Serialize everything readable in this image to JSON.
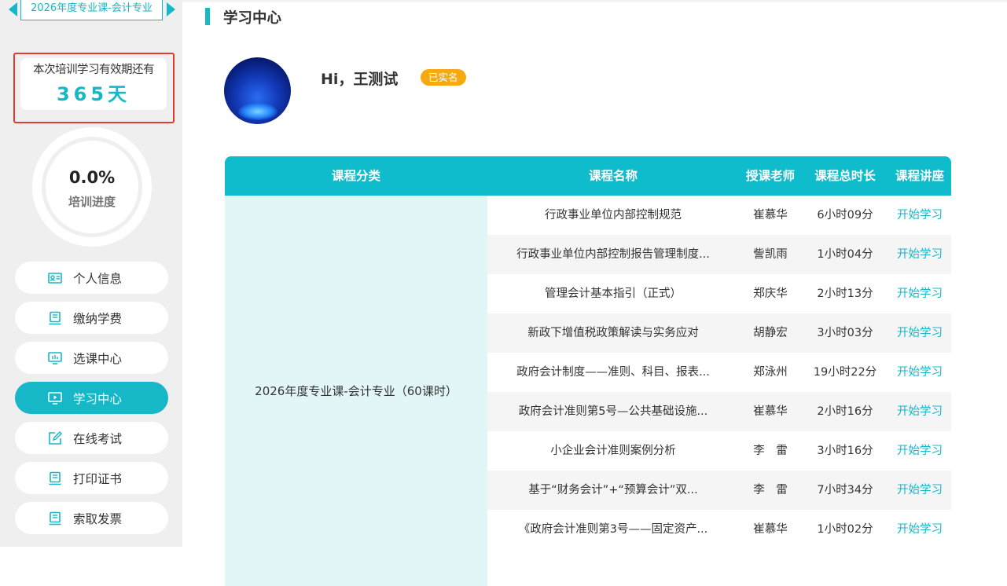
{
  "sidebar": {
    "course_name": "2026年度专业课-会计专业",
    "validity_label": "本次培训学习有效期还有",
    "validity_days": "365天",
    "progress_value": "0.0%",
    "progress_fraction": 0.0,
    "progress_label": "培训进度",
    "nav": [
      {
        "label": "个人信息",
        "icon": "id-card-icon"
      },
      {
        "label": "缴纳学费",
        "icon": "payment-icon"
      },
      {
        "label": "选课中心",
        "icon": "monitor-icon"
      },
      {
        "label": "学习中心",
        "icon": "video-icon",
        "active": true
      },
      {
        "label": "在线考试",
        "icon": "edit-icon"
      },
      {
        "label": "打印证书",
        "icon": "printer-icon"
      },
      {
        "label": "索取发票",
        "icon": "invoice-icon"
      }
    ]
  },
  "main": {
    "title": "学习中心",
    "greeting": "Hi，王测试",
    "verified_badge": "已实名"
  },
  "table": {
    "headers": {
      "category": "课程分类",
      "name": "课程名称",
      "teacher": "授课老师",
      "duration": "课程总时长",
      "action": "课程讲座"
    },
    "category": "2026年度专业课-会计专业（60课时）",
    "rows": [
      {
        "name": "行政事业单位内部控制规范",
        "teacher": "崔慕华",
        "duration": "6小时09分",
        "action": "开始学习"
      },
      {
        "name": "行政事业单位内部控制报告管理制度...",
        "teacher": "訾凯雨",
        "duration": "1小时04分",
        "action": "开始学习"
      },
      {
        "name": "管理会计基本指引（正式）",
        "teacher": "郑庆华",
        "duration": "2小时13分",
        "action": "开始学习"
      },
      {
        "name": "新政下增值税政策解读与实务应对",
        "teacher": "胡静宏",
        "duration": "3小时03分",
        "action": "开始学习"
      },
      {
        "name": "政府会计制度——准则、科目、报表...",
        "teacher": "郑泳州",
        "duration": "19小时22分",
        "action": "开始学习"
      },
      {
        "name": "政府会计准则第5号—公共基础设施...",
        "teacher": "崔慕华",
        "duration": "2小时16分",
        "action": "开始学习"
      },
      {
        "name": "小企业会计准则案例分析",
        "teacher": "李　雷",
        "duration": "3小时16分",
        "action": "开始学习"
      },
      {
        "name": "基于“财务会计”+“预算会计”双...",
        "teacher": "李　雷",
        "duration": "7小时34分",
        "action": "开始学习"
      },
      {
        "name": "《政府会计准则第3号——固定资产...",
        "teacher": "崔慕华",
        "duration": "1小时02分",
        "action": "开始学习"
      }
    ]
  },
  "colors": {
    "accent": "#16b7c6",
    "badge": "#f7a90f",
    "highlight_border": "#e23a2c"
  }
}
